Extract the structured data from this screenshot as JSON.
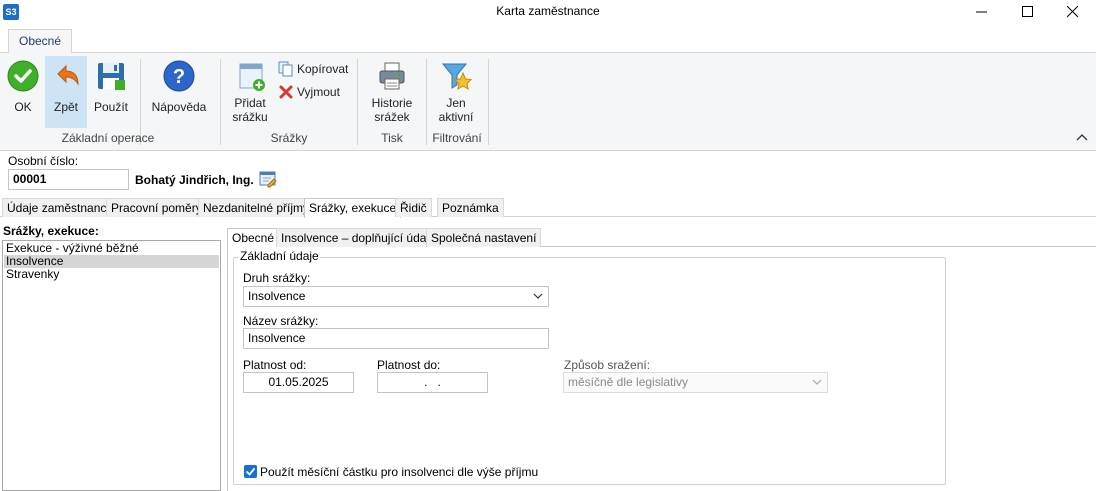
{
  "window": {
    "app_logo": "S3",
    "title": "Karta zaměstnance"
  },
  "ribbon": {
    "tab": "Obecné",
    "groups": {
      "zakladni": "Základní operace",
      "srazky": "Srážky",
      "tisk": "Tisk",
      "filtrovani": "Filtrování"
    },
    "buttons": {
      "ok": "OK",
      "zpet": "Zpět",
      "pouzit": "Použít",
      "napoveda": "Nápověda",
      "pridat_line1": "Přidat",
      "pridat_line2": "srážku",
      "kopirovat": "Kopírovat",
      "vyjmout": "Vyjmout",
      "historie_line1": "Historie",
      "historie_line2": "srážek",
      "jen_line1": "Jen",
      "jen_line2": "aktivní"
    }
  },
  "header": {
    "osobni_cislo_label": "Osobní číslo:",
    "osobni_cislo": "00001",
    "jmeno": "Bohatý Jindřich, Ing."
  },
  "tabs": [
    "Údaje zaměstnance",
    "Pracovní poměry",
    "Nezdanitelné příjmy",
    "Srážky, exekuce",
    "Řidič",
    "Poznámka"
  ],
  "left_panel": {
    "title": "Srážky, exekuce:",
    "items": [
      "Exekuce - výživné běžné",
      "Insolvence",
      "Stravenky"
    ]
  },
  "subtabs": [
    "Obecné",
    "Insolvence – doplňující údaje",
    "Společná nastavení"
  ],
  "form": {
    "group_title": "Základní údaje",
    "druh_label": "Druh srážky:",
    "druh_value": "Insolvence",
    "nazev_label": "Název srážky:",
    "nazev_value": "Insolvence",
    "platnost_od_label": "Platnost od:",
    "platnost_od_value": "01.05.2025",
    "platnost_do_label": "Platnost do:",
    "platnost_do_value": ".   .",
    "zpusob_label": "Způsob sražení:",
    "zpusob_value": "měsíčně dle legislativy",
    "checkbox_label": "Použít měsíční částku pro insolvenci dle výše příjmu",
    "checkbox_checked": true
  },
  "colors": {
    "accent": "#1a6fd0",
    "ribbon_bg": "#f5f6f7",
    "active_button_bg": "#cde4f7",
    "selected_item_bg": "#d6d6d6"
  }
}
